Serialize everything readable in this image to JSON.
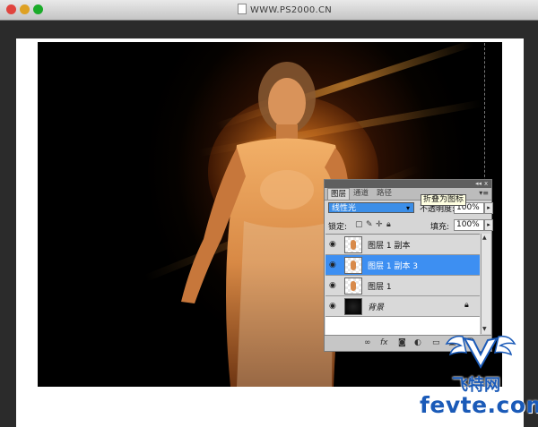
{
  "window": {
    "document_title": "WWW.PS2000.CN",
    "traffic_lights": {
      "close": "#e0443e",
      "minimize": "#dea123",
      "maximize": "#1aab29"
    }
  },
  "layers_panel": {
    "tabs": [
      "图层",
      "通道",
      "路径"
    ],
    "active_tab": "图层",
    "tooltip": "折叠为图标",
    "blend_mode": "线性光",
    "opacity_label": "不透明度:",
    "opacity_value": "100%",
    "lock_label": "锁定:",
    "fill_label": "填充:",
    "fill_value": "100%",
    "layers": [
      {
        "name": "图层 1 副本",
        "selected": false,
        "locked": false
      },
      {
        "name": "图层 1 副本 3",
        "selected": true,
        "locked": false
      },
      {
        "name": "图层 1",
        "selected": false,
        "locked": false
      },
      {
        "name": "背景",
        "selected": false,
        "locked": true
      }
    ],
    "accent_color": "#3d8ff2"
  },
  "watermark": {
    "cn_text": "飞特网",
    "en_text": "fevte.com",
    "color": "#1a5ab8"
  }
}
